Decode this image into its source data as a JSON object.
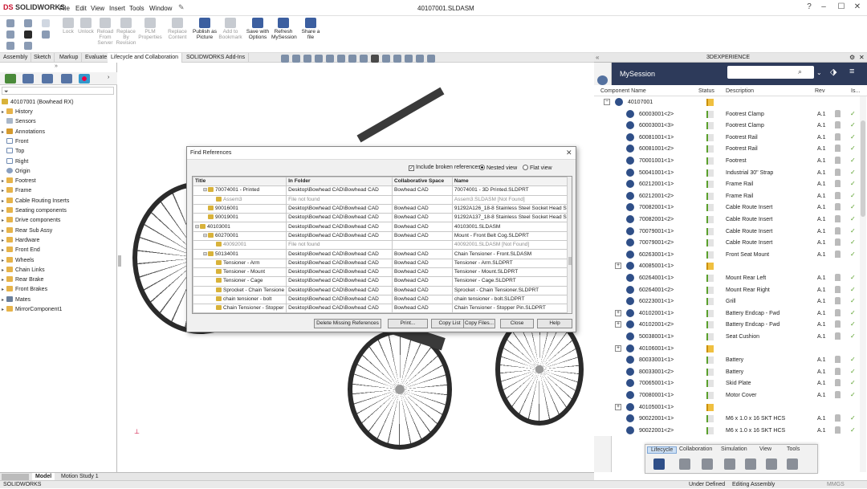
{
  "app": {
    "brand_ds": "DS",
    "brand": "SOLIDWORKS",
    "window_title": "40107001.SLDASM",
    "status_app": "SOLIDWORKS",
    "status_state": "Under Defined",
    "status_mode": "Editing Assembly",
    "status_units": "MMGS"
  },
  "menu": [
    "File",
    "Edit",
    "View",
    "Insert",
    "Tools",
    "Window"
  ],
  "ribbon": [
    {
      "label": "Lock",
      "on": false
    },
    {
      "label": "Unlock",
      "on": false
    },
    {
      "label": "Reload From Server",
      "on": false
    },
    {
      "label": "Replace By Revision",
      "on": false
    },
    {
      "label": "PLM Properties",
      "on": false
    },
    {
      "label": "Replace Content",
      "on": false
    },
    {
      "label": "Publish as Picture",
      "on": true
    },
    {
      "label": "Add to Bookmark",
      "on": false
    },
    {
      "label": "Save with Options",
      "on": true
    },
    {
      "label": "Refresh MySession",
      "on": true
    },
    {
      "label": "Share a file",
      "on": true
    }
  ],
  "tabs": [
    "Assembly",
    "Sketch",
    "Markup",
    "Evaluate",
    "Lifecycle and Collaboration",
    "SOLIDWORKS Add-Ins"
  ],
  "tree": {
    "root": "40107001 (Bowhead RX)",
    "items": [
      {
        "label": "History",
        "icon": "folder-icon",
        "toggle": "▸"
      },
      {
        "label": "Sensors",
        "icon": "sensor-icon",
        "toggle": ""
      },
      {
        "label": "Annotations",
        "icon": "annotation-icon",
        "toggle": "▸"
      },
      {
        "label": "Front",
        "icon": "plane-icon",
        "toggle": ""
      },
      {
        "label": "Top",
        "icon": "plane-icon",
        "toggle": ""
      },
      {
        "label": "Right",
        "icon": "plane-icon",
        "toggle": ""
      },
      {
        "label": "Origin",
        "icon": "origin-icon",
        "toggle": ""
      },
      {
        "label": "Footrest",
        "icon": "folder-icon",
        "toggle": "▸"
      },
      {
        "label": "Frame",
        "icon": "folder-icon",
        "toggle": "▸"
      },
      {
        "label": "Cable Routing Inserts",
        "icon": "folder-icon",
        "toggle": "▸"
      },
      {
        "label": "Seating components",
        "icon": "folder-icon",
        "toggle": "▸"
      },
      {
        "label": "Drive components",
        "icon": "folder-icon",
        "toggle": "▸"
      },
      {
        "label": "Rear Sub Assy",
        "icon": "folder-icon",
        "toggle": "▸"
      },
      {
        "label": "Hardware",
        "icon": "folder-icon",
        "toggle": "▸"
      },
      {
        "label": "Front End",
        "icon": "folder-icon",
        "toggle": "▸"
      },
      {
        "label": "Wheels",
        "icon": "folder-icon",
        "toggle": "▸"
      },
      {
        "label": "Chain Links",
        "icon": "folder-icon",
        "toggle": "▸"
      },
      {
        "label": "Rear Brake",
        "icon": "folder-icon",
        "toggle": "▸"
      },
      {
        "label": "Front Brakes",
        "icon": "folder-icon",
        "toggle": "▸"
      },
      {
        "label": "Mates",
        "icon": "mates-icon",
        "toggle": "▸"
      },
      {
        "label": "MirrorComponent1",
        "icon": "mirror-icon",
        "toggle": "▸"
      }
    ]
  },
  "bottom_tabs": [
    "Model",
    "Motion Study 1"
  ],
  "dialog": {
    "title": "Find References",
    "include_broken": "Include broken references",
    "nested": "Nested view",
    "flat": "Flat view",
    "columns": [
      "Title",
      "In Folder",
      "Collaborative Space",
      "Name"
    ],
    "rows": [
      {
        "ind": 1,
        "tg": "⊟",
        "title": "70074001 - Printed",
        "folder": "Desktop\\Bowhead CAD\\Bowhead CAD",
        "space": "Bowhead CAD",
        "name": "70074001 - 3D Printed.SLDPRT",
        "miss": false
      },
      {
        "ind": 2,
        "tg": "",
        "title": "Assem3",
        "folder": "File not found",
        "space": "",
        "name": "Assem3.SLDASM [Not Found]",
        "miss": true
      },
      {
        "ind": 1,
        "tg": "",
        "title": "90016001",
        "folder": "Desktop\\Bowhead CAD\\Bowhead CAD",
        "space": "Bowhead CAD",
        "name": "91292A126_18-8 Stainless Steel Socket Head Sc",
        "miss": false
      },
      {
        "ind": 1,
        "tg": "",
        "title": "90019001",
        "folder": "Desktop\\Bowhead CAD\\Bowhead CAD",
        "space": "Bowhead CAD",
        "name": "91292A137_18-8 Stainless Steel Socket Head Sc",
        "miss": false
      },
      {
        "ind": 0,
        "tg": "⊟",
        "title": "40103001",
        "folder": "Desktop\\Bowhead CAD\\Bowhead CAD",
        "space": "Bowhead CAD",
        "name": "40103001.SLDASM",
        "miss": false
      },
      {
        "ind": 1,
        "tg": "⊟",
        "title": "60270001",
        "folder": "Desktop\\Bowhead CAD\\Bowhead CAD",
        "space": "Bowhead CAD",
        "name": "Mount - Front Belt Cog.SLDPRT",
        "miss": false
      },
      {
        "ind": 2,
        "tg": "",
        "title": "40092001",
        "folder": "File not found",
        "space": "",
        "name": "40092001.SLDASM [Not Found]",
        "miss": true
      },
      {
        "ind": 1,
        "tg": "⊟",
        "title": "50134001",
        "folder": "Desktop\\Bowhead CAD\\Bowhead CAD",
        "space": "Bowhead CAD",
        "name": "Chain Tensioner - Front.SLDASM",
        "miss": false
      },
      {
        "ind": 2,
        "tg": "",
        "title": "Tensioner - Arm",
        "folder": "Desktop\\Bowhead CAD\\Bowhead CAD",
        "space": "Bowhead CAD",
        "name": "Tensioner - Arm.SLDPRT",
        "miss": false
      },
      {
        "ind": 2,
        "tg": "",
        "title": "Tensioner - Mount",
        "folder": "Desktop\\Bowhead CAD\\Bowhead CAD",
        "space": "Bowhead CAD",
        "name": "Tensioner - Mount.SLDPRT",
        "miss": false
      },
      {
        "ind": 2,
        "tg": "",
        "title": "Tensioner - Cage",
        "folder": "Desktop\\Bowhead CAD\\Bowhead CAD",
        "space": "Bowhead CAD",
        "name": "Tensioner - Cage.SLDPRT",
        "miss": false
      },
      {
        "ind": 2,
        "tg": "",
        "title": "Sprocket - Chain Tensione",
        "folder": "Desktop\\Bowhead CAD\\Bowhead CAD",
        "space": "Bowhead CAD",
        "name": "Sprocket - Chain Tensioner.SLDPRT",
        "miss": false
      },
      {
        "ind": 2,
        "tg": "",
        "title": "chain tensioner - bolt",
        "folder": "Desktop\\Bowhead CAD\\Bowhead CAD",
        "space": "Bowhead CAD",
        "name": "chain tensioner - bolt.SLDPRT",
        "miss": false
      },
      {
        "ind": 2,
        "tg": "",
        "title": "Chain Tensioner - Stopper",
        "folder": "Desktop\\Bowhead CAD\\Bowhead CAD",
        "space": "Bowhead CAD",
        "name": "Chain Tensioner - Stopper Pin.SLDPRT",
        "miss": false
      },
      {
        "ind": 2,
        "tg": "",
        "title": "Chain Tensioner - Center",
        "folder": "Desktop\\Bowhead CAD\\Bowhead CAD",
        "space": "Bowhead CAD",
        "name": "Chain Tensioner - Center Pin.SLDPRT",
        "miss": false
      }
    ],
    "buttons": [
      "Delete Missing References",
      "Print...",
      "Copy List",
      "Copy Files...",
      "Close",
      "Help"
    ]
  },
  "right": {
    "panel_title": "3DEXPERIENCE",
    "session_title": "MySession",
    "columns": [
      "Component Name",
      "Status",
      "Description",
      "Rev",
      "Is..."
    ],
    "rows": [
      {
        "name": "40107001",
        "desc": "",
        "rev": "",
        "lvl": 0,
        "tg": "−",
        "st": "y"
      },
      {
        "name": "60003001<2>",
        "desc": "Footrest Clamp",
        "rev": "A.1",
        "lvl": 1,
        "tg": "",
        "st": "g"
      },
      {
        "name": "60003001<3>",
        "desc": "Footrest Clamp",
        "rev": "A.1",
        "lvl": 1,
        "tg": "",
        "st": "g"
      },
      {
        "name": "60081001<1>",
        "desc": "Footrest Rail",
        "rev": "A.1",
        "lvl": 1,
        "tg": "",
        "st": "g"
      },
      {
        "name": "60081001<2>",
        "desc": "Footrest Rail",
        "rev": "A.1",
        "lvl": 1,
        "tg": "",
        "st": "g"
      },
      {
        "name": "70001001<1>",
        "desc": "Footrest",
        "rev": "A.1",
        "lvl": 1,
        "tg": "",
        "st": "g"
      },
      {
        "name": "50041001<1>",
        "desc": "Industrial 30\" Strap",
        "rev": "A.1",
        "lvl": 1,
        "tg": "",
        "st": "g"
      },
      {
        "name": "60212001<1>",
        "desc": "Frame Rail",
        "rev": "A.1",
        "lvl": 1,
        "tg": "",
        "st": "g"
      },
      {
        "name": "60212001<2>",
        "desc": "Frame Rail",
        "rev": "A.1",
        "lvl": 1,
        "tg": "",
        "st": "g"
      },
      {
        "name": "70082001<1>",
        "desc": "Cable Route Insert",
        "rev": "A.1",
        "lvl": 1,
        "tg": "",
        "st": "g"
      },
      {
        "name": "70082001<2>",
        "desc": "Cable Route Insert",
        "rev": "A.1",
        "lvl": 1,
        "tg": "",
        "st": "g"
      },
      {
        "name": "70079001<1>",
        "desc": "Cable Route Insert",
        "rev": "A.1",
        "lvl": 1,
        "tg": "",
        "st": "g"
      },
      {
        "name": "70079001<2>",
        "desc": "Cable Route Insert",
        "rev": "A.1",
        "lvl": 1,
        "tg": "",
        "st": "g"
      },
      {
        "name": "60263001<1>",
        "desc": "Front Seat Mount",
        "rev": "A.1",
        "lvl": 1,
        "tg": "",
        "st": "g"
      },
      {
        "name": "40085001<1>",
        "desc": "",
        "rev": "",
        "lvl": 1,
        "tg": "+",
        "st": "y"
      },
      {
        "name": "60264001<1>",
        "desc": "Mount Rear Left",
        "rev": "A.1",
        "lvl": 1,
        "tg": "",
        "st": "g"
      },
      {
        "name": "60264001<2>",
        "desc": "Mount Rear Right",
        "rev": "A.1",
        "lvl": 1,
        "tg": "",
        "st": "g"
      },
      {
        "name": "60223001<1>",
        "desc": "Grill",
        "rev": "A.1",
        "lvl": 1,
        "tg": "",
        "st": "g"
      },
      {
        "name": "40102001<1>",
        "desc": "Battery Endcap - Fwd",
        "rev": "A.1",
        "lvl": 1,
        "tg": "+",
        "st": "g"
      },
      {
        "name": "40102001<2>",
        "desc": "Battery Endcap - Fwd",
        "rev": "A.1",
        "lvl": 1,
        "tg": "+",
        "st": "g"
      },
      {
        "name": "50038001<1>",
        "desc": "Seat Cushion",
        "rev": "A.1",
        "lvl": 1,
        "tg": "",
        "st": "g"
      },
      {
        "name": "40106001<1>",
        "desc": "",
        "rev": "",
        "lvl": 1,
        "tg": "+",
        "st": "y"
      },
      {
        "name": "80033001<1>",
        "desc": "Battery",
        "rev": "A.1",
        "lvl": 1,
        "tg": "",
        "st": "g"
      },
      {
        "name": "80033001<2>",
        "desc": "Battery",
        "rev": "A.1",
        "lvl": 1,
        "tg": "",
        "st": "g"
      },
      {
        "name": "70065001<1>",
        "desc": "Skid Plate",
        "rev": "A.1",
        "lvl": 1,
        "tg": "",
        "st": "g"
      },
      {
        "name": "70080001<1>",
        "desc": "Motor Cover",
        "rev": "A.1",
        "lvl": 1,
        "tg": "",
        "st": "g"
      },
      {
        "name": "40105001<1>",
        "desc": "",
        "rev": "",
        "lvl": 1,
        "tg": "+",
        "st": "y"
      },
      {
        "name": "90022001<1>",
        "desc": "M6 x 1.0 x 16 SKT HCS",
        "rev": "A.1",
        "lvl": 1,
        "tg": "",
        "st": "g"
      },
      {
        "name": "90022001<2>",
        "desc": "M6 x 1.0 x 16 SKT HCS",
        "rev": "A.1",
        "lvl": 1,
        "tg": "",
        "st": "g"
      }
    ],
    "lc_tabs": [
      "Lifecycle",
      "Collaboration",
      "Simulation",
      "View",
      "Tools"
    ]
  }
}
